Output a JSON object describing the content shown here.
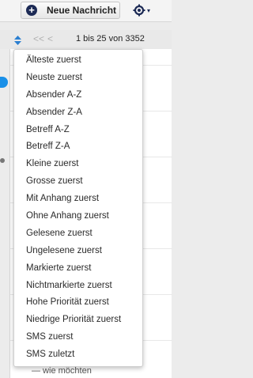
{
  "toolbar": {
    "new_message_label": "Neue Nachricht",
    "new_message_icon": "plus-circle-icon",
    "settings_icon": "gear-icon",
    "caret_glyph": "▾"
  },
  "listbar": {
    "first_glyph": "<<",
    "prev_glyph": "<",
    "pagination_text": "1 bis 25 von 3352"
  },
  "background": {
    "peek_text": "— wie möchten"
  },
  "sort_menu": {
    "items": [
      "Älteste zuerst",
      "Neuste zuerst",
      "Absender A-Z",
      "Absender Z-A",
      "Betreff A-Z",
      "Betreff Z-A",
      "Kleine zuerst",
      "Grosse zuerst",
      "Mit Anhang zuerst",
      "Ohne Anhang zuerst",
      "Gelesene zuerst",
      "Ungelesene zuerst",
      "Markierte zuerst",
      "Nichtmarkierte zuerst",
      "Hohe Priorität zuerst",
      "Niedrige Priorität zuerst",
      "SMS zuerst",
      "SMS zuletzt"
    ]
  },
  "colors": {
    "accent_navy": "#1c2a55",
    "unread_blue": "#1a90e8",
    "sort_arrow_blue": "#2a7fd0"
  }
}
